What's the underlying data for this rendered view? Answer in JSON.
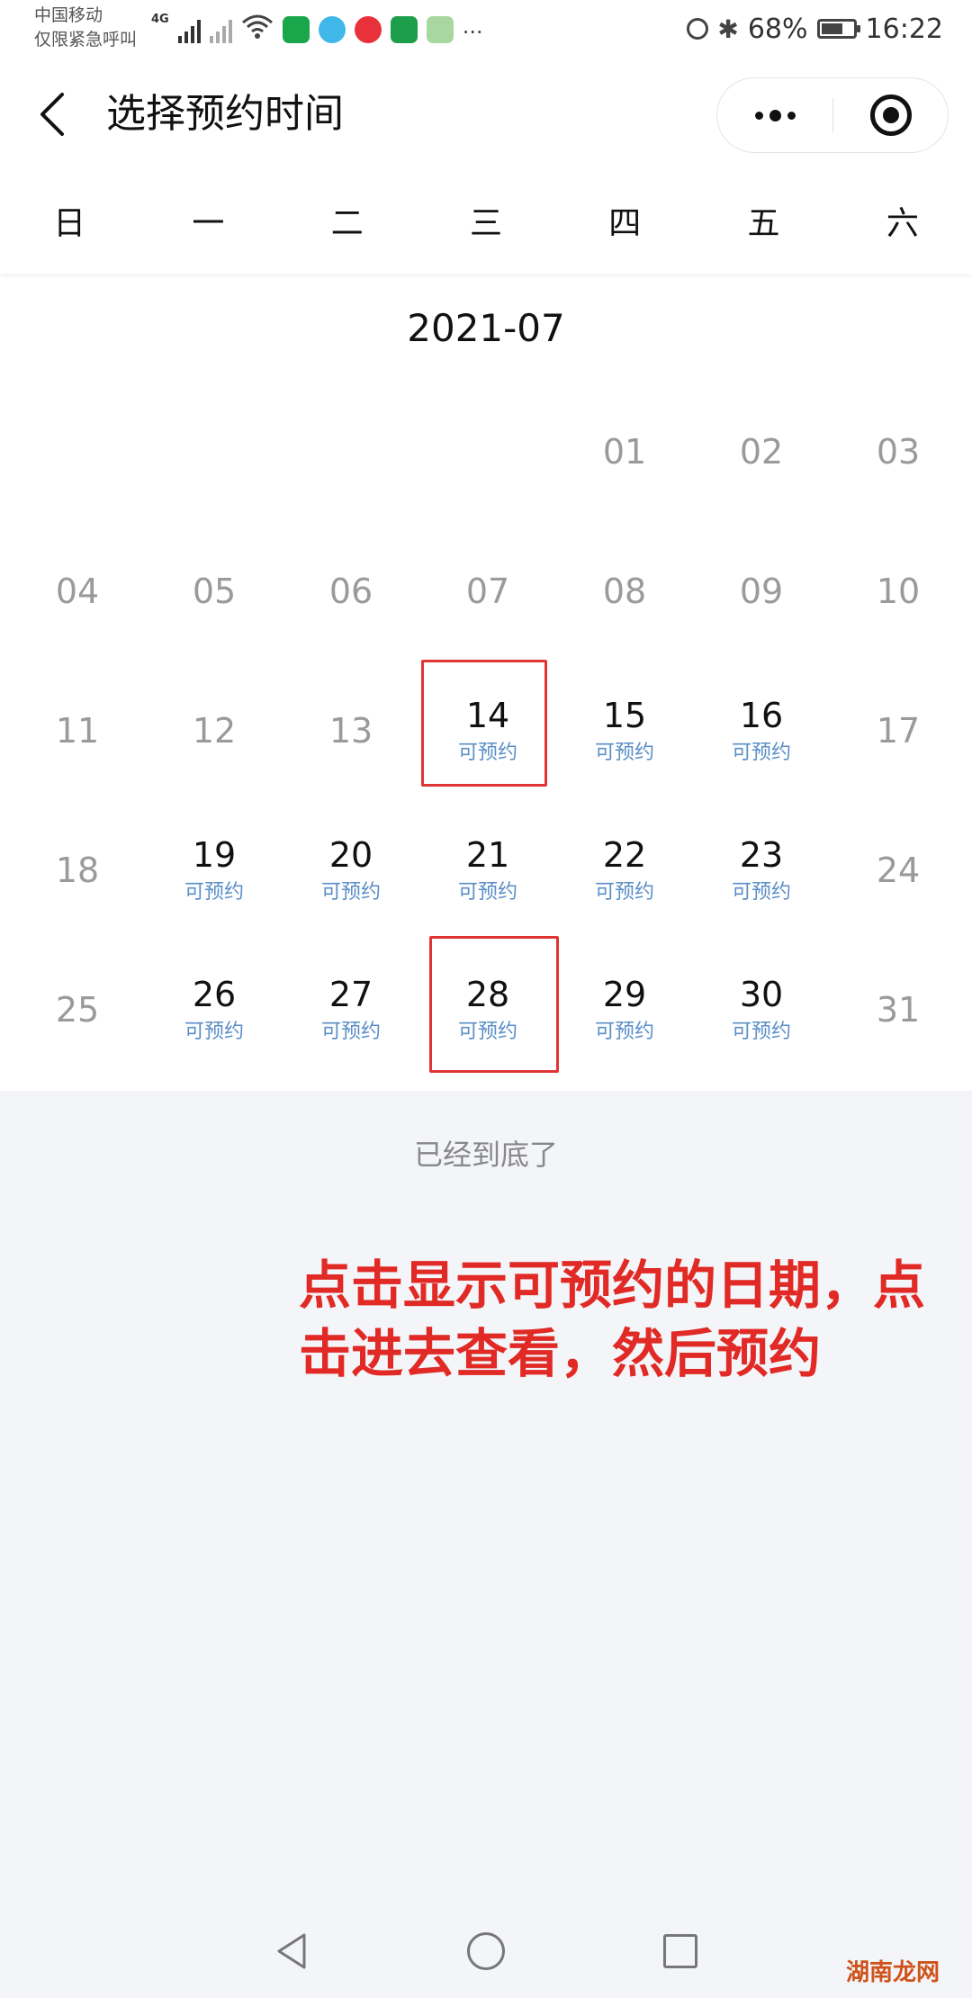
{
  "status_bar": {
    "carrier_line1": "中国移动",
    "carrier_line2": "仅限紧急呼叫",
    "network_type": "4G",
    "more": "···",
    "battery_text": "68%",
    "battery_level": 0.68,
    "time": "16:22"
  },
  "header": {
    "title": "选择预约时间",
    "back_icon": "chevron-left-icon",
    "more_icon": "more-dots-icon",
    "close_icon": "target-circle-icon"
  },
  "weekdays": [
    "日",
    "一",
    "二",
    "三",
    "四",
    "五",
    "六"
  ],
  "calendar": {
    "month": "2021-07",
    "leading_blanks": 4,
    "days": [
      {
        "num": "01",
        "status": ""
      },
      {
        "num": "02",
        "status": ""
      },
      {
        "num": "03",
        "status": ""
      },
      {
        "num": "04",
        "status": ""
      },
      {
        "num": "05",
        "status": ""
      },
      {
        "num": "06",
        "status": ""
      },
      {
        "num": "07",
        "status": ""
      },
      {
        "num": "08",
        "status": ""
      },
      {
        "num": "09",
        "status": ""
      },
      {
        "num": "10",
        "status": ""
      },
      {
        "num": "11",
        "status": ""
      },
      {
        "num": "12",
        "status": ""
      },
      {
        "num": "13",
        "status": ""
      },
      {
        "num": "14",
        "status": "可预约"
      },
      {
        "num": "15",
        "status": "可预约"
      },
      {
        "num": "16",
        "status": "可预约"
      },
      {
        "num": "17",
        "status": ""
      },
      {
        "num": "18",
        "status": ""
      },
      {
        "num": "19",
        "status": "可预约"
      },
      {
        "num": "20",
        "status": "可预约"
      },
      {
        "num": "21",
        "status": "可预约"
      },
      {
        "num": "22",
        "status": "可预约"
      },
      {
        "num": "23",
        "status": "可预约"
      },
      {
        "num": "24",
        "status": ""
      },
      {
        "num": "25",
        "status": ""
      },
      {
        "num": "26",
        "status": "可预约"
      },
      {
        "num": "27",
        "status": "可预约"
      },
      {
        "num": "28",
        "status": "可预约"
      },
      {
        "num": "29",
        "status": "可预约"
      },
      {
        "num": "30",
        "status": "可预约"
      },
      {
        "num": "31",
        "status": ""
      }
    ],
    "highlighted": [
      "14",
      "28"
    ]
  },
  "end_text": "已经到底了",
  "annotation": "点击显示可预约的日期，点击进去查看，然后预约",
  "colors": {
    "bookable_text": "#5a8ec7",
    "highlight_border": "#e03535",
    "annotation": "#e12a25"
  },
  "watermark": "湖南龙网"
}
